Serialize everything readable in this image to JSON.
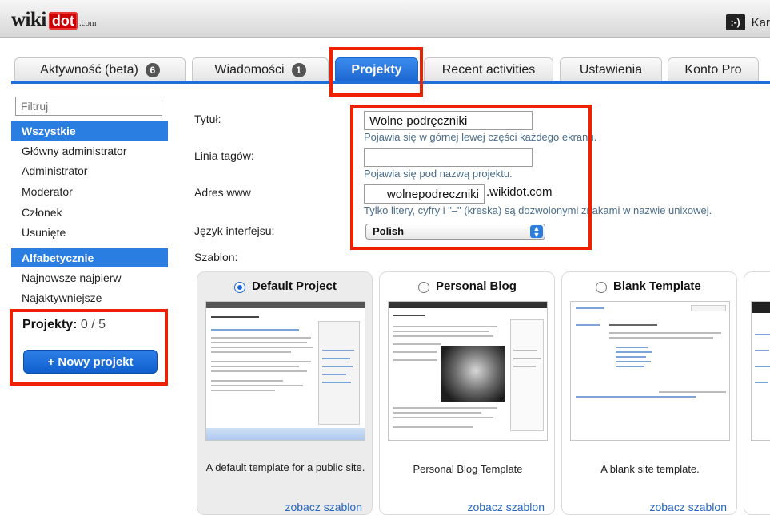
{
  "header": {
    "logo_text_main": "wiki",
    "logo_text_dot": "dot",
    "logo_text_com": ".com",
    "user_icon_text": ":-)",
    "user_name": "Kar"
  },
  "tabs": [
    {
      "label": "Aktywność (beta)",
      "badge": "6"
    },
    {
      "label": "Wiadomości",
      "badge": "1"
    },
    {
      "label": "Projekty",
      "active": true
    },
    {
      "label": "Recent activities"
    },
    {
      "label": "Ustawienia"
    },
    {
      "label": "Konto Pro"
    }
  ],
  "sidebar": {
    "filter_placeholder": "Filtruj",
    "group1": [
      "Wszystkie",
      "Główny administrator",
      "Administrator",
      "Moderator",
      "Członek",
      "Usunięte"
    ],
    "group2": [
      "Alfabetycznie",
      "Najnowsze najpierw",
      "Najaktywniejsze"
    ],
    "projects_label": "Projekty:",
    "projects_count": "0 / 5",
    "new_project_label": "+ Nowy projekt"
  },
  "form": {
    "title_label": "Tytuł:",
    "title_value": "Wolne podręczniki",
    "title_hint": "Pojawia się w górnej lewej części każdego ekranu.",
    "tagline_label": "Linia tagów:",
    "tagline_value": "",
    "tagline_hint": "Pojawia się pod nazwą projektu.",
    "url_label": "Adres www",
    "url_value": "wolnepodreczniki",
    "url_suffix": ".wikidot.com",
    "url_hint": "Tylko litery, cyfry i \"–\" (kreska) są dozwolonymi znakami w nazwie unixowej.",
    "lang_label": "Język interfejsu:",
    "lang_value": "Polish",
    "template_label": "Szablon:"
  },
  "templates": [
    {
      "name": "Default Project",
      "selected": true,
      "description": "A default template for a public site.",
      "link": "zobacz szablon"
    },
    {
      "name": "Personal Blog",
      "selected": false,
      "description": "Personal Blog Template",
      "link": "zobacz szablon"
    },
    {
      "name": "Blank Template",
      "selected": false,
      "description": "A blank site template.",
      "link": "zobacz szablon"
    }
  ],
  "colors": {
    "accent": "#2a7de1",
    "highlight": "#ee2200",
    "hint_text": "#4a6d8c"
  },
  "icons": [
    "user-icon",
    "select-arrow-icon",
    "radio-icon"
  ]
}
